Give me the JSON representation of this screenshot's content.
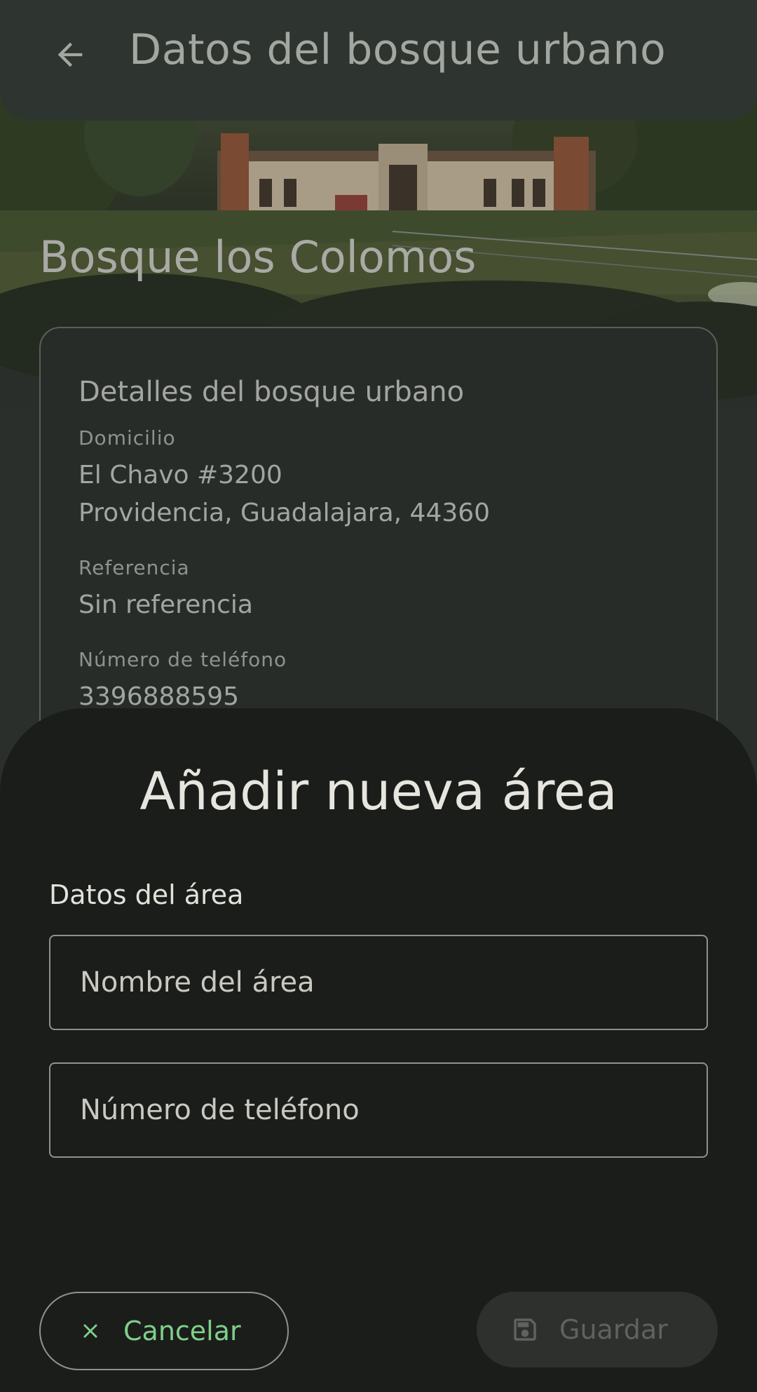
{
  "appbar": {
    "title": "Datos del bosque urbano",
    "back_icon": "arrow-left-icon"
  },
  "forest": {
    "name": "Bosque los Colomos"
  },
  "details": {
    "title": "Detalles del bosque urbano",
    "address_label": "Domicilio",
    "address_line1": "El Chavo #3200",
    "address_line2": "Providencia, Guadalajara, 44360",
    "reference_label": "Referencia",
    "reference_value": "Sin referencia",
    "phone_label": "Número de teléfono",
    "phone_value": "3396888595"
  },
  "sheet": {
    "title": "Añadir nueva área",
    "section_label": "Datos del área",
    "area_name_placeholder": "Nombre del área",
    "area_phone_placeholder": "Número de teléfono",
    "cancel_label": "Cancelar",
    "save_label": "Guardar"
  },
  "colors": {
    "accent_green": "#7fd089",
    "sheet_bg": "#1b1d1b",
    "appbar_bg": "#2e3530"
  }
}
